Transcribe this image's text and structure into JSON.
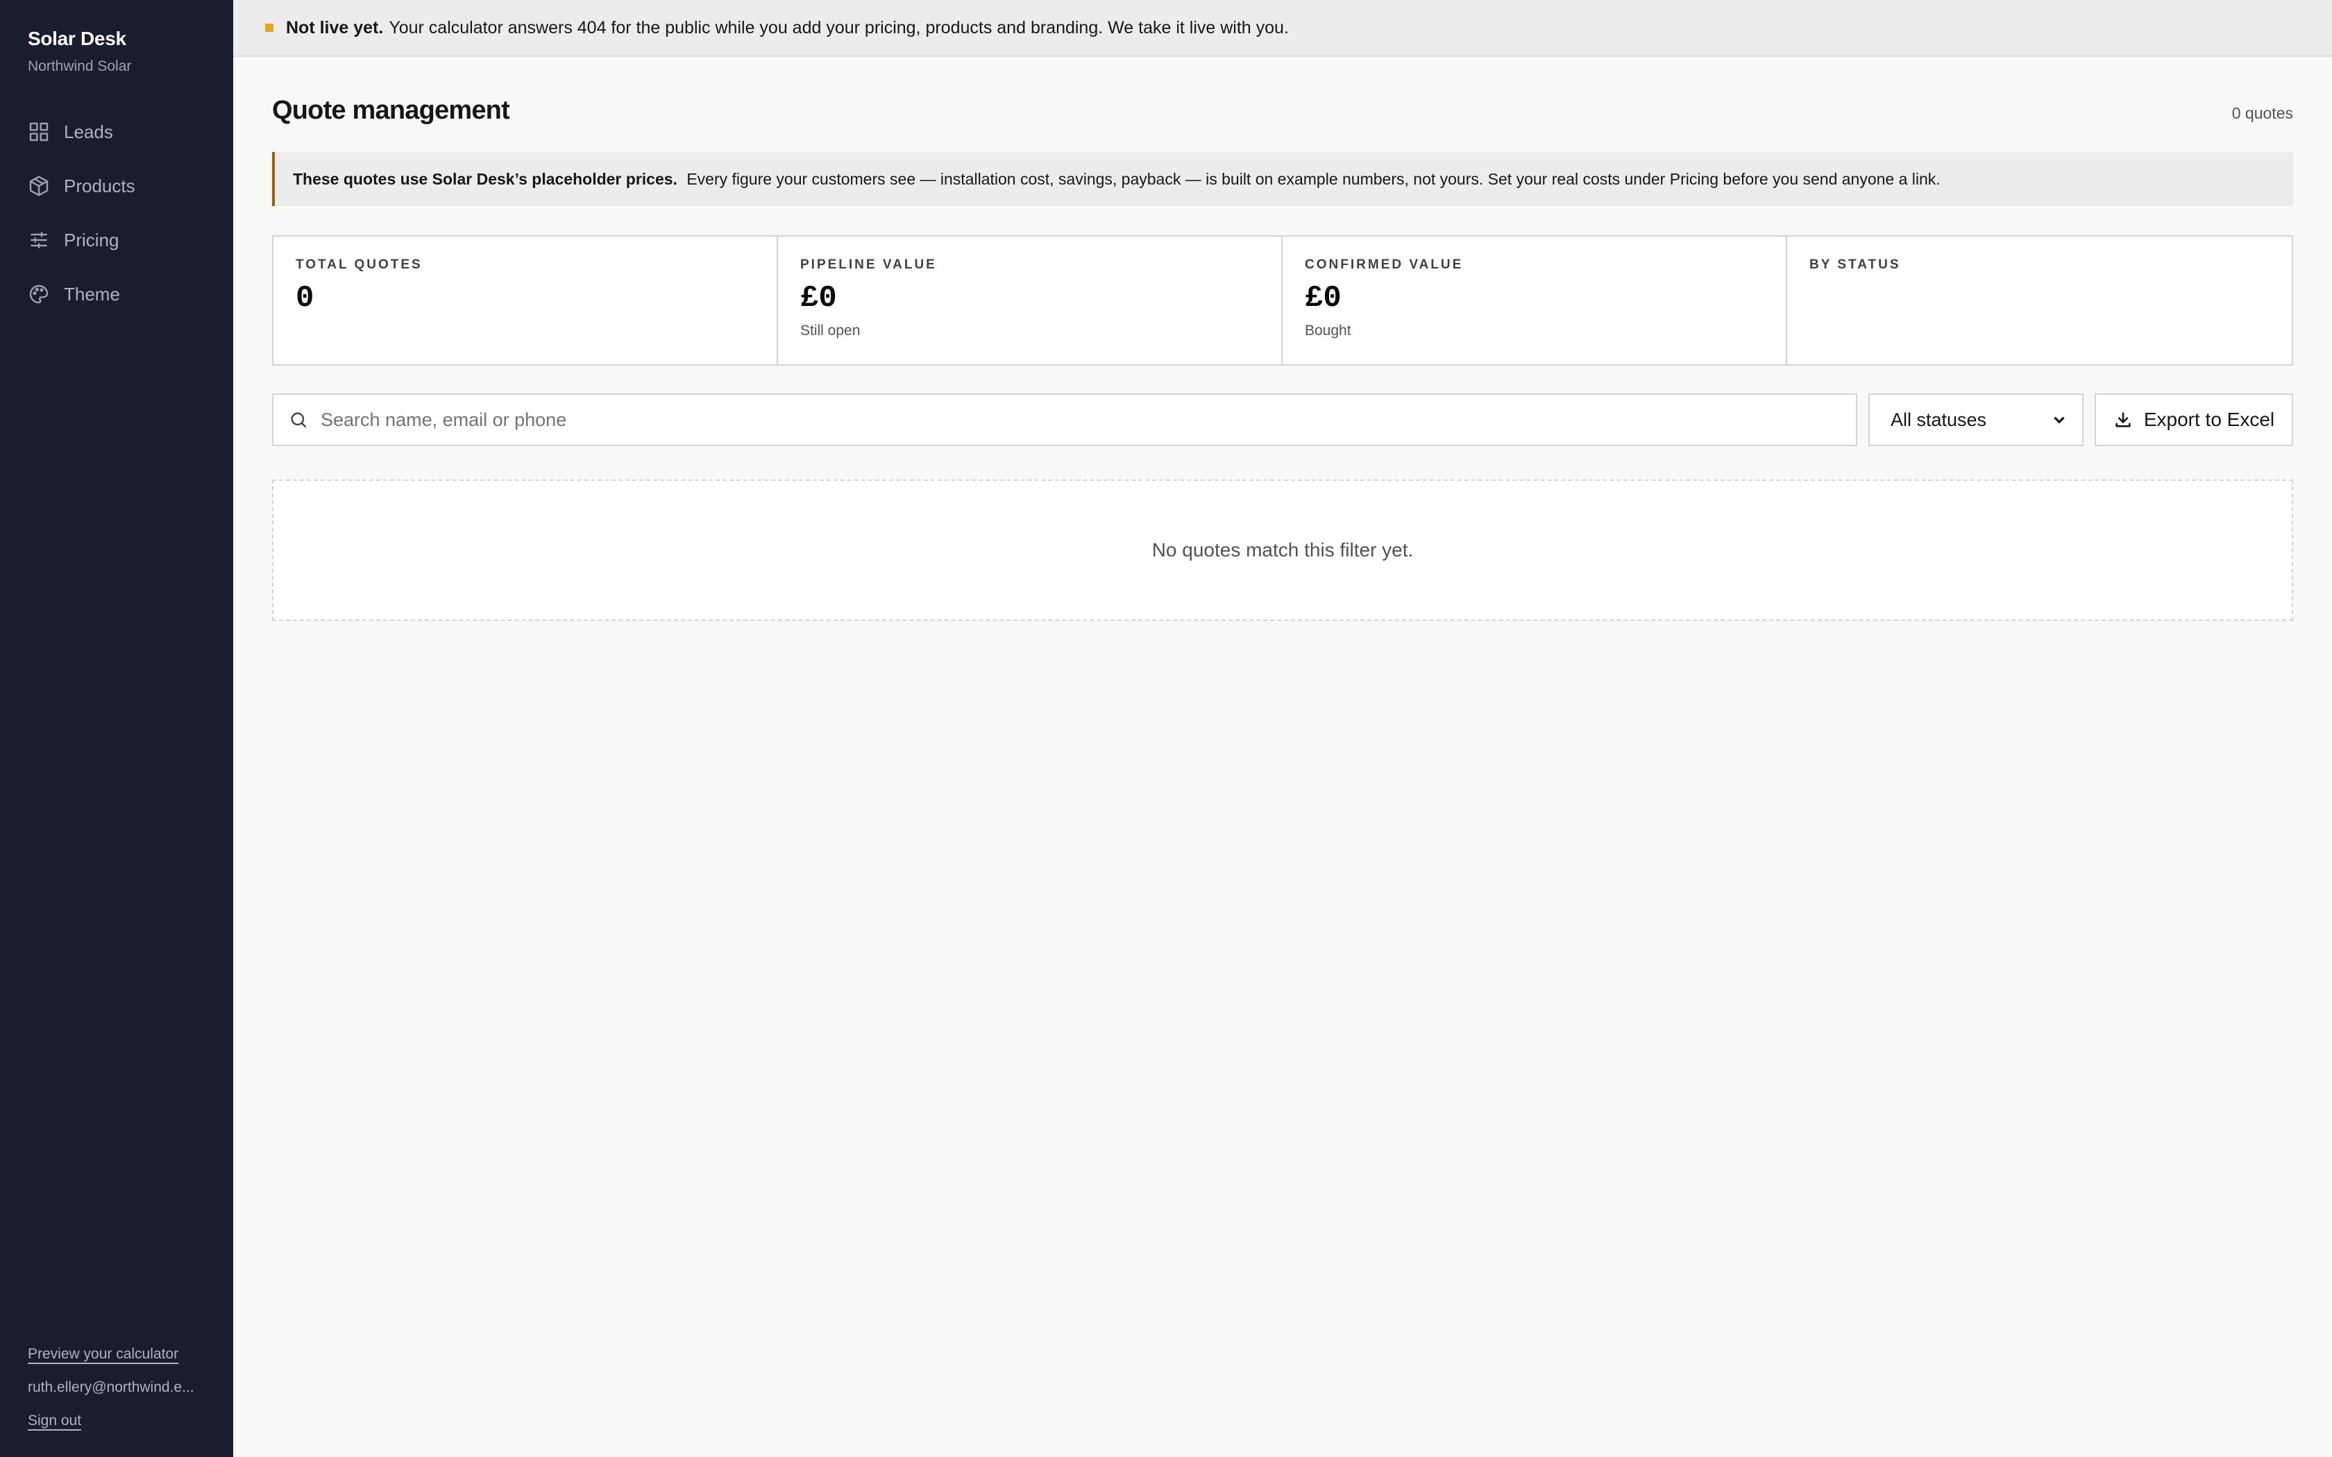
{
  "sidebar": {
    "brand_name": "Solar Desk",
    "org_name": "Northwind Solar",
    "nav": [
      {
        "label": "Leads",
        "icon": "grid-icon"
      },
      {
        "label": "Products",
        "icon": "box-icon"
      },
      {
        "label": "Pricing",
        "icon": "sliders-icon"
      },
      {
        "label": "Theme",
        "icon": "palette-icon"
      }
    ],
    "footer": {
      "preview_link": "Preview your calculator",
      "user_email": "ruth.ellery@northwind.e...",
      "sign_out": "Sign out"
    }
  },
  "banner": {
    "bold": "Not live yet.",
    "text": "Your calculator answers 404 for the public while you add your pricing, products and branding. We take it live with you.",
    "dot_color": "#e9a417"
  },
  "header": {
    "title": "Quote management",
    "count": "0 quotes"
  },
  "notice": {
    "bold": "These quotes use Solar Desk’s placeholder prices.",
    "text": "Every figure your customers see — installation cost, savings, payback — is built on example numbers, not yours. Set your real costs under Pricing before you send anyone a link.",
    "accent_color": "#a16207"
  },
  "stats": [
    {
      "label": "TOTAL QUOTES",
      "value": "0",
      "sub": ""
    },
    {
      "label": "PIPELINE VALUE",
      "value": "£0",
      "sub": "Still open"
    },
    {
      "label": "CONFIRMED VALUE",
      "value": "£0",
      "sub": "Bought"
    },
    {
      "label": "BY STATUS",
      "value": "",
      "sub": ""
    }
  ],
  "filters": {
    "search_placeholder": "Search name, email or phone",
    "search_value": "",
    "status_selected": "All statuses",
    "export_label": "Export to Excel"
  },
  "empty_state": {
    "message": "No quotes match this filter yet."
  }
}
